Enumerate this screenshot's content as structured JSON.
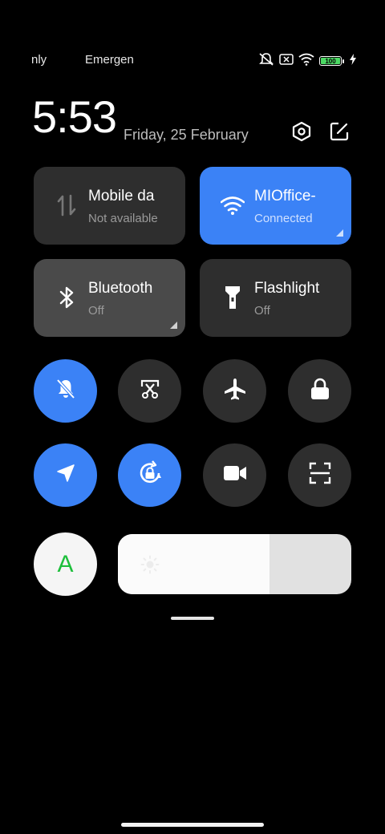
{
  "status_bar": {
    "left_text_1": "nly",
    "left_text_2": "Emergen",
    "battery_level": "100",
    "battery_color": "#4cd964",
    "icons": [
      "mute-icon",
      "no-sim-icon",
      "wifi-icon",
      "battery-icon",
      "charging-icon"
    ]
  },
  "header": {
    "time": "5:53",
    "date": "Friday, 25 February",
    "icons": [
      "settings-icon",
      "edit-icon"
    ]
  },
  "tiles": [
    {
      "title": "Mobile da",
      "subtitle": "Not available",
      "icon": "mobile-data-icon",
      "active": false
    },
    {
      "title": "MIOffice-",
      "subtitle": "Connected",
      "icon": "wifi-icon",
      "active": true
    },
    {
      "title": "Bluetooth",
      "subtitle": "Off",
      "icon": "bluetooth-icon",
      "active": false
    },
    {
      "title": "Flashlight",
      "subtitle": "Off",
      "icon": "flashlight-icon",
      "active": false
    }
  ],
  "toggles": [
    {
      "icon": "mute-bell-icon",
      "on": true
    },
    {
      "icon": "screenshot-icon",
      "on": false
    },
    {
      "icon": "airplane-icon",
      "on": false
    },
    {
      "icon": "lock-icon",
      "on": false
    },
    {
      "icon": "location-icon",
      "on": true
    },
    {
      "icon": "rotation-lock-icon",
      "on": true
    },
    {
      "icon": "screen-record-icon",
      "on": false
    },
    {
      "icon": "scanner-icon",
      "on": false
    }
  ],
  "auto_brightness_label": "A",
  "brightness": {
    "level": 0.65,
    "icon": "sun-icon"
  },
  "colors": {
    "accent": "#3b82f6",
    "tile_bg": "#2e2e2e",
    "auto_green": "#1dbf3b"
  }
}
